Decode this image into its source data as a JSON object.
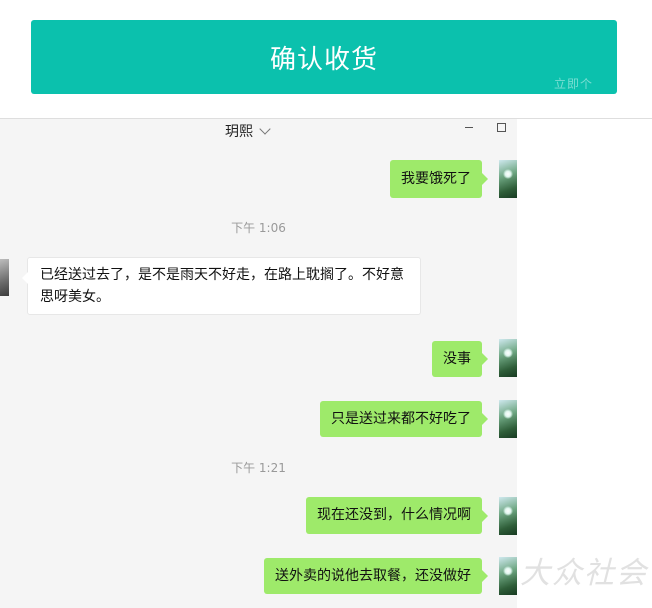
{
  "top_bar": {
    "confirm_button_label": "确认收货",
    "button_ghost_text": "立即个"
  },
  "chat_window": {
    "title": "玥熙",
    "messages": [
      {
        "type": "sent",
        "text": "我要饿死了"
      },
      {
        "type": "timestamp",
        "text": "下午 1:06"
      },
      {
        "type": "received",
        "text": "已经送过去了，是不是雨天不好走，在路上耽搁了。不好意思呀美女。"
      },
      {
        "type": "sent",
        "text": "没事"
      },
      {
        "type": "sent",
        "text": "只是送过来都不好吃了"
      },
      {
        "type": "timestamp",
        "text": "下午 1:21"
      },
      {
        "type": "sent",
        "text": "现在还没到，什么情况啊"
      },
      {
        "type": "sent",
        "text": "送外卖的说他去取餐，还没做好"
      }
    ]
  },
  "watermark": "大众社会",
  "colors": {
    "button_teal": "#0bc1ad",
    "sent_bubble_green": "#9eea6a",
    "chat_background": "#f5f5f5"
  }
}
